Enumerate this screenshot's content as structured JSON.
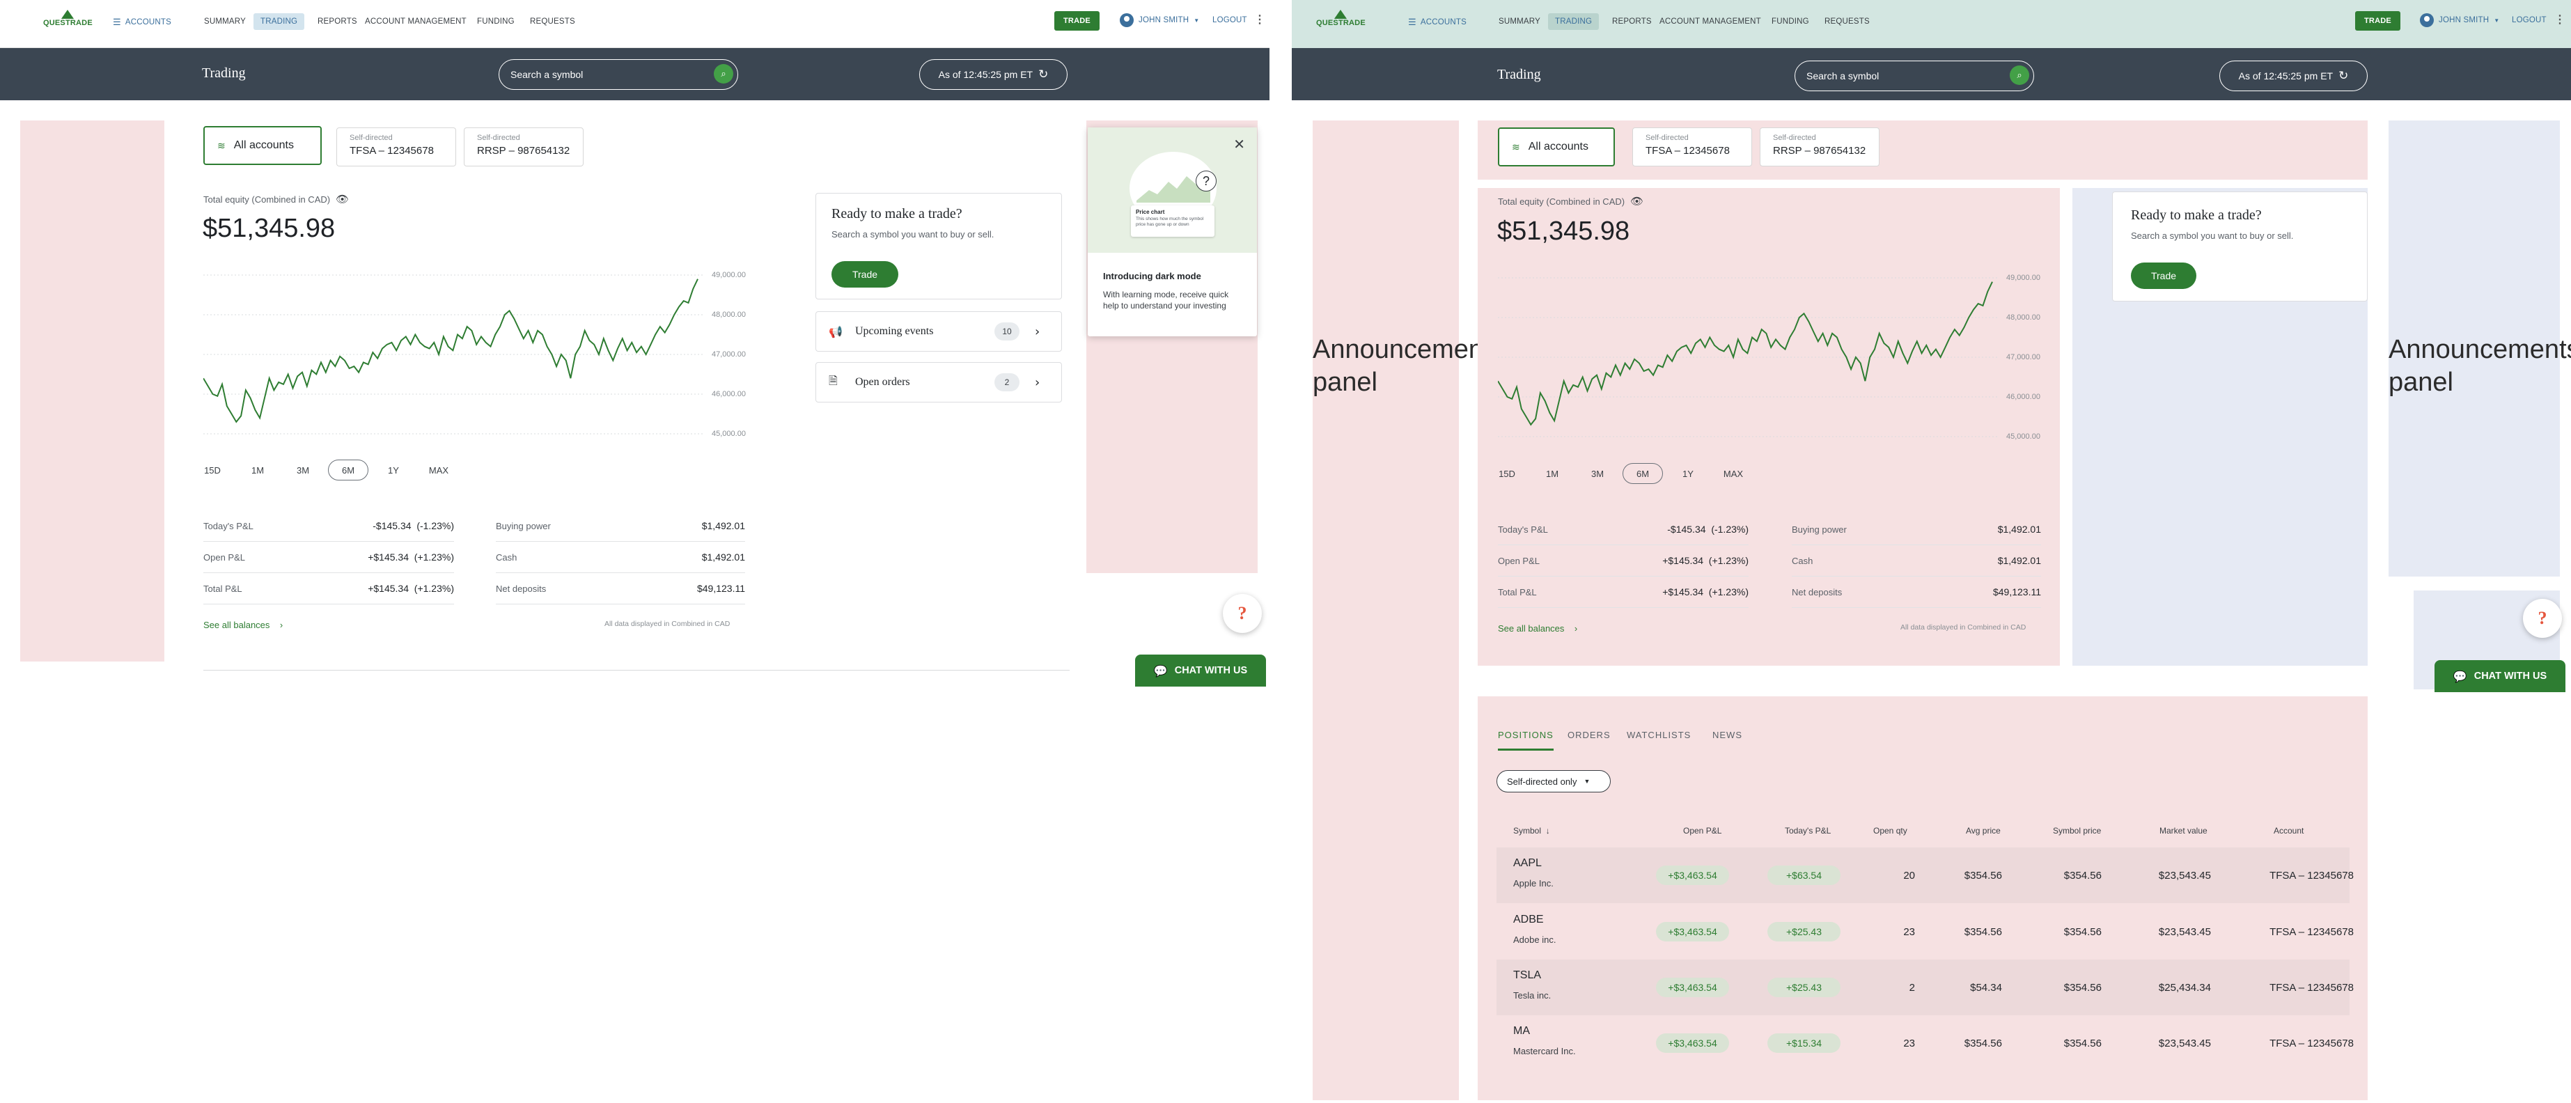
{
  "nav": {
    "logo": "QUESTRADE",
    "accounts": "ACCOUNTS",
    "items": [
      "SUMMARY",
      "TRADING",
      "REPORTS",
      "ACCOUNT MANAGEMENT",
      "FUNDING",
      "REQUESTS"
    ],
    "trade_button": "TRADE",
    "user": "JOHN SMITH",
    "logout": "LOGOUT"
  },
  "header": {
    "title": "Trading",
    "search_placeholder": "Search a symbol",
    "as_of": "As of 12:45:25 pm ET"
  },
  "accounts_tabs": {
    "all": "All accounts",
    "tfsa_label": "Self-directed",
    "tfsa_value": "TFSA – 12345678",
    "rrsp_label": "Self-directed",
    "rrsp_value": "RRSP – 987654132"
  },
  "equity": {
    "label": "Total equity (Combined in CAD)",
    "value": "$51,345.98"
  },
  "timeframes": [
    "15D",
    "1M",
    "3M",
    "6M",
    "1Y",
    "MAX"
  ],
  "selected_timeframe": "6M",
  "pnl": {
    "todays_label": "Today's P&L",
    "todays_value": "-$145.34",
    "todays_pct": "(-1.23%)",
    "open_label": "Open P&L",
    "open_value": "+$145.34",
    "open_pct": "(+1.23%)",
    "total_label": "Total P&L",
    "total_value": "+$145.34",
    "total_pct": "(+1.23%)"
  },
  "balances": {
    "buying_power_label": "Buying power",
    "buying_power": "$1,492.01",
    "cash_label": "Cash",
    "cash": "$1,492.01",
    "net_deposits_label": "Net deposits",
    "net_deposits": "$49,123.11"
  },
  "see_all_balances": "See all balances",
  "data_note": "All data displayed in Combined in CAD",
  "trade_card": {
    "title": "Ready to make a trade?",
    "desc": "Search a symbol you want to buy or sell.",
    "button": "Trade"
  },
  "upcoming_events": {
    "label": "Upcoming events",
    "count": "10"
  },
  "open_orders": {
    "label": "Open orders",
    "count": "2"
  },
  "popup": {
    "title": "Introducing dark mode",
    "body": "With learning mode, receive quick help to understand your investing",
    "thumb_title": "Price chart",
    "thumb_body": "This shows how much the symbol price has gone up or down"
  },
  "announcements": "Announcements panel",
  "help": "?",
  "chat": "CHAT WITH US",
  "chart_data": {
    "type": "line",
    "title": "",
    "ylabel": "",
    "y_ticks": [
      "49,000.00",
      "48,000.00",
      "47,000.00",
      "46,000.00",
      "45,000.00"
    ],
    "ylim": [
      45000,
      49000
    ],
    "grid": true,
    "series": [
      {
        "values": [
          46400,
          46200,
          46000,
          45950,
          46250,
          45700,
          45500,
          45300,
          45450,
          46100,
          45900,
          45600,
          45400,
          45900,
          46400,
          46100,
          46300,
          46250,
          46500,
          46150,
          46450,
          46550,
          46200,
          46600,
          46500,
          46800,
          46550,
          46850,
          46700,
          46950,
          46850,
          46650,
          46700,
          46550,
          46800,
          46750,
          47050,
          46900,
          47150,
          47250,
          47300,
          47100,
          47350,
          47450,
          47250,
          47500,
          47300,
          47200,
          47150,
          47300,
          47000,
          47450,
          47200,
          47100,
          47500,
          47400,
          47700,
          47600,
          47250,
          47450,
          47300,
          47200,
          47500,
          47700,
          48000,
          48100,
          47900,
          47650,
          47400,
          47600,
          47300,
          47600,
          47500,
          47200,
          47000,
          46700,
          47000,
          46850,
          46400,
          47000,
          47200,
          47600,
          47350,
          47250,
          47000,
          47400,
          47100,
          46850,
          47150,
          47400,
          47100,
          47300,
          47050,
          47200,
          47000,
          47250,
          47500,
          47700,
          47550,
          47750,
          48000,
          48200,
          48350,
          48300,
          48650,
          48900
        ]
      }
    ]
  },
  "positions": {
    "tabs": [
      "POSITIONS",
      "ORDERS",
      "WATCHLISTS",
      "NEWS"
    ],
    "filter": "Self-directed only",
    "headers": [
      "Symbol",
      "Open P&L",
      "Today's P&L",
      "Open qty",
      "Avg price",
      "Symbol price",
      "Market value",
      "Account"
    ],
    "rows": [
      {
        "symbol": "AAPL",
        "name": "Apple Inc.",
        "open_pnl": "+$3,463.54",
        "today_pnl": "+$63.54",
        "qty": "20",
        "avg": "$354.56",
        "price": "$354.56",
        "mv": "$23,543.45",
        "account": "TFSA – 12345678"
      },
      {
        "symbol": "ADBE",
        "name": "Adobe inc.",
        "open_pnl": "+$3,463.54",
        "today_pnl": "+$25.43",
        "qty": "23",
        "avg": "$354.56",
        "price": "$354.56",
        "mv": "$23,543.45",
        "account": "TFSA – 12345678"
      },
      {
        "symbol": "TSLA",
        "name": "Tesla inc.",
        "open_pnl": "+$3,463.54",
        "today_pnl": "+$25.43",
        "qty": "2",
        "avg": "$54.34",
        "price": "$354.56",
        "mv": "$25,434.34",
        "account": "TFSA – 12345678"
      },
      {
        "symbol": "MA",
        "name": "Mastercard Inc.",
        "open_pnl": "+$3,463.54",
        "today_pnl": "+$15.34",
        "qty": "23",
        "avg": "$354.56",
        "price": "$354.56",
        "mv": "$23,543.45",
        "account": "TFSA – 12345678"
      }
    ]
  }
}
